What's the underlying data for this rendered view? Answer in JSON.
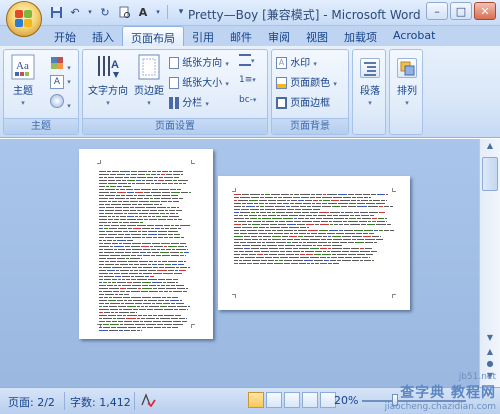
{
  "window": {
    "title": "Pretty—Boy [兼容模式] - Microsoft Word"
  },
  "quick_access": {
    "icons": [
      "save-icon",
      "undo-icon",
      "redo-icon",
      "print-preview-icon",
      "font-color-icon",
      "customize-icon"
    ]
  },
  "tabs": [
    {
      "label": "开始",
      "active": false
    },
    {
      "label": "插入",
      "active": false
    },
    {
      "label": "页面布局",
      "active": true
    },
    {
      "label": "引用",
      "active": false
    },
    {
      "label": "邮件",
      "active": false
    },
    {
      "label": "审阅",
      "active": false
    },
    {
      "label": "视图",
      "active": false
    },
    {
      "label": "加载项",
      "active": false
    },
    {
      "label": "Acrobat",
      "active": false
    }
  ],
  "ribbon": {
    "theme_group": {
      "label": "主题",
      "theme_button": "主题"
    },
    "page_setup_group": {
      "label": "页面设置",
      "text_direction": "文字方向",
      "margins": "页边距",
      "orientation": "纸张方向",
      "size": "纸张大小",
      "columns": "分栏"
    },
    "page_background_group": {
      "label": "页面背景",
      "watermark": "水印",
      "page_color": "页面颜色",
      "page_borders": "页面边框"
    },
    "paragraph_group": {
      "label": "段落"
    },
    "arrange_group": {
      "label": "排列"
    }
  },
  "status": {
    "page": "页面: 2/2",
    "words": "字数: 1,412",
    "zoom": "20%"
  },
  "watermark": {
    "top": "jb51.net",
    "middle": "查字典 教程网",
    "bottom": "jiaocheng.chazidian.com"
  },
  "colors": {
    "ribbon_bg": "#dbe8f8",
    "doc_bg": "#9cbce4",
    "accent": "#15428b"
  }
}
